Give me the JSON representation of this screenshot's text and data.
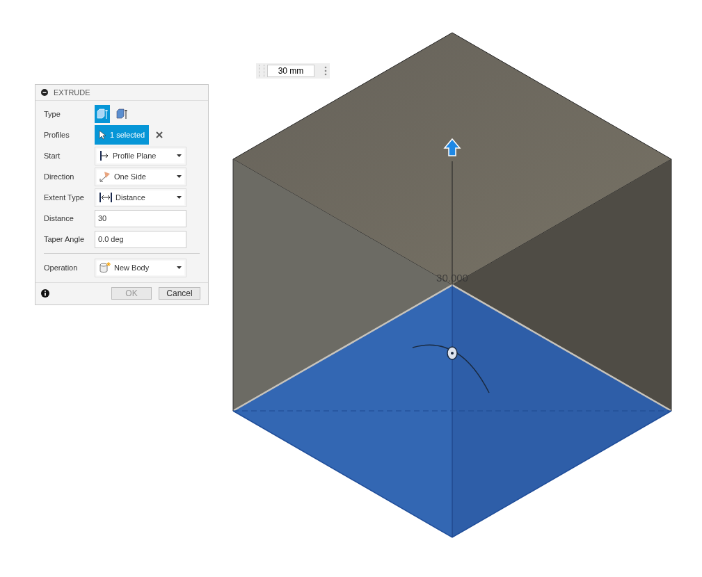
{
  "dimension_input": {
    "value": "30 mm"
  },
  "dialog": {
    "title": "EXTRUDE",
    "rows": [
      {
        "kind": "type",
        "label": "Type",
        "options": [
          {
            "selected": true
          },
          {
            "selected": false
          }
        ]
      },
      {
        "kind": "selection",
        "label": "Profiles",
        "value": "1 selected"
      },
      {
        "kind": "dropdown",
        "label": "Start",
        "value": "Profile Plane"
      },
      {
        "kind": "dropdown",
        "label": "Direction",
        "value": "One Side"
      },
      {
        "kind": "dropdown",
        "label": "Extent Type",
        "value": "Distance"
      },
      {
        "kind": "input",
        "label": "Distance",
        "value": "30"
      },
      {
        "kind": "input",
        "label": "Taper Angle",
        "value": "0.0 deg"
      },
      {
        "kind": "divider"
      },
      {
        "kind": "dropdown",
        "label": "Operation",
        "value": "New Body"
      }
    ],
    "buttons": [
      {
        "label": "OK",
        "disabled": true
      },
      {
        "label": "Cancel",
        "disabled": false
      }
    ]
  },
  "viewport": {
    "dimension_label": "30.000"
  }
}
